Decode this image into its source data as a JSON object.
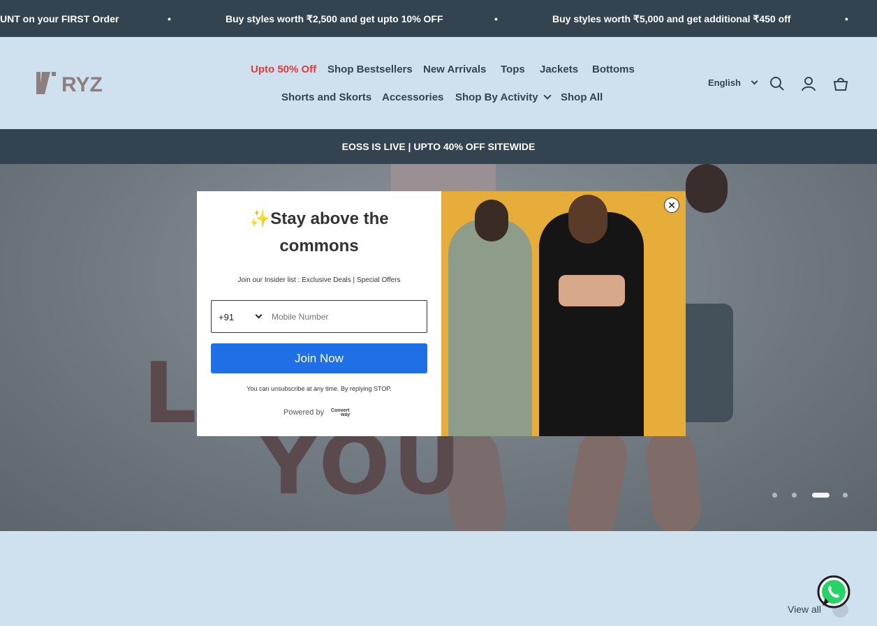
{
  "announcement": {
    "items": [
      "UNT on your FIRST Order",
      "Buy styles worth ₹2,500 and get upto 10% OFF",
      "Buy styles worth ₹5,000 and get additional ₹450 off"
    ],
    "separator": "•"
  },
  "header": {
    "logo_text": "RYZ",
    "nav": [
      "Upto 50% Off",
      "Shop Bestsellers",
      "New Arrivals",
      "Tops",
      "Jackets",
      "Bottoms",
      "Shorts and Skorts",
      "Accessories",
      "Shop By Activity",
      "Shop All"
    ],
    "language": "English",
    "icons": [
      "search-icon",
      "account-icon",
      "cart-icon"
    ]
  },
  "promo_bar": "EOSS IS LIVE | UPTO 40% OFF SITEWIDE",
  "hero": {
    "text_line1": "LI",
    "text_line2": "YOU",
    "slides_total": 4,
    "active_slide": 3
  },
  "popup": {
    "title_line1": "Stay above the",
    "title_line2": "commons",
    "emoji": "✨",
    "subtitle": "Join our Insider list : Exclusive Deals | Special Offers",
    "country_code": "+91",
    "phone_placeholder": "Mobile Number",
    "join_label": "Join Now",
    "unsubscribe_note": "You can unsubscribe at any time. By replying STOP.",
    "powered_by": "Powered by",
    "powered_brand_line1": "Convert",
    "powered_brand_line2": "way"
  },
  "section": {
    "view_all": "View all"
  },
  "colors": {
    "dark": "#33434f",
    "sale": "#e03b3b",
    "page_bg": "#cfe0ee",
    "join_button": "#1f6fe6",
    "popup_image_bg": "#e6ad3a"
  }
}
